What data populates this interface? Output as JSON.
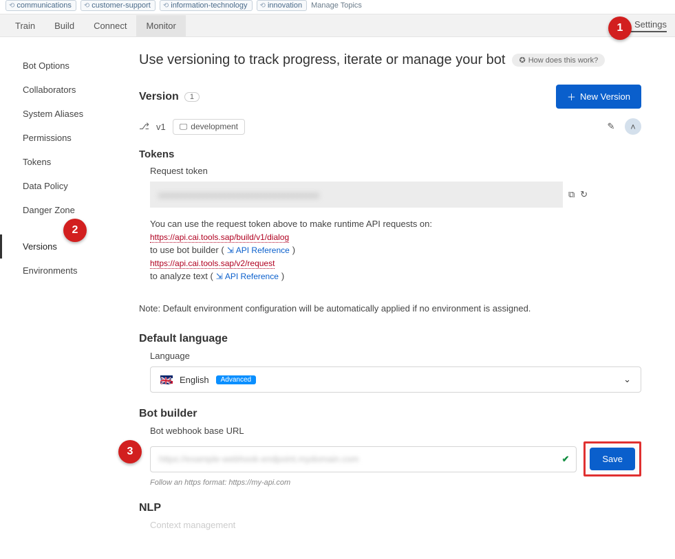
{
  "topics": {
    "tags": [
      "communications",
      "customer-support",
      "information-technology",
      "innovation"
    ],
    "manage_label": "Manage Topics"
  },
  "nav": {
    "tabs": [
      "Train",
      "Build",
      "Connect",
      "Monitor"
    ],
    "settings_label": "Settings"
  },
  "sidebar": {
    "group1": [
      "Bot Options",
      "Collaborators",
      "System Aliases",
      "Permissions",
      "Tokens",
      "Data Policy",
      "Danger Zone"
    ],
    "group2": [
      "Versions",
      "Environments"
    ],
    "active": "Versions"
  },
  "page": {
    "title": "Use versioning to track progress, iterate or manage your bot",
    "help_label": "How does this work?"
  },
  "version": {
    "heading": "Version",
    "count": "1",
    "new_button": "New Version",
    "v_label": "v1",
    "env_label": "development"
  },
  "tokens": {
    "heading": "Tokens",
    "subheading": "Request token",
    "token_value": "xxxxxxxxxxxxxxxxxxxxxxxxxxxxxxxxxxxx",
    "desc": "You can use the request token above to make runtime API requests on:",
    "url1": "https://api.cai.tools.sap/build/v1/dialog",
    "line1_pre": "to use bot builder (",
    "api_ref": "API Reference",
    "line1_post": ")",
    "url2": "https://api.cai.tools.sap/v2/request",
    "line2_pre": "to analyze text (",
    "line2_post": ")"
  },
  "note": "Note: Default environment configuration will be automatically applied if no environment is assigned.",
  "default_lang": {
    "heading": "Default language",
    "label": "Language",
    "value": "English",
    "badge": "Advanced"
  },
  "bot_builder": {
    "heading": "Bot builder",
    "label": "Bot webhook base URL",
    "value": "https://example-webhook-endpoint.mydomain.com",
    "hint": "Follow an https format: https://my-api.com",
    "save_label": "Save"
  },
  "nlp": {
    "heading": "NLP",
    "sub": "Context management"
  },
  "markers": {
    "m1": "1",
    "m2": "2",
    "m3": "3"
  }
}
